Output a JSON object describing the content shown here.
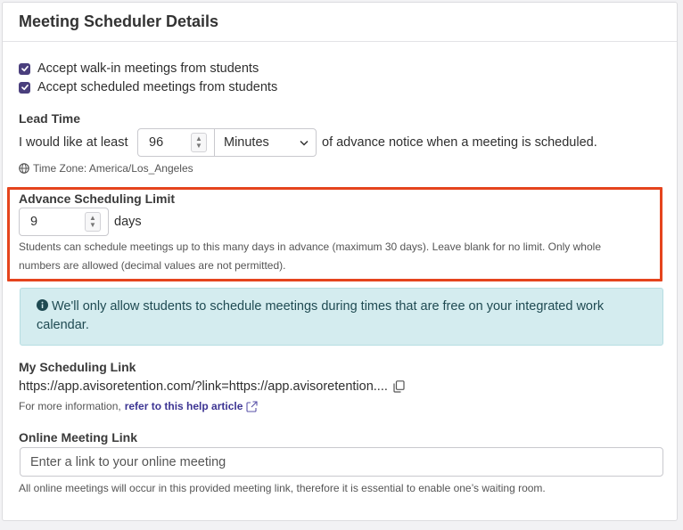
{
  "header": {
    "title": "Meeting Scheduler Details"
  },
  "checkboxes": [
    {
      "label": "Accept walk-in meetings from students",
      "checked": true
    },
    {
      "label": "Accept scheduled meetings from students",
      "checked": true
    }
  ],
  "lead_time": {
    "heading": "Lead Time",
    "prefix": "I would like at least",
    "value": "96",
    "unit_selected": "Minutes",
    "suffix": "of advance notice when a meeting is scheduled.",
    "timezone": "Time Zone: America/Los_Angeles"
  },
  "advance_limit": {
    "heading": "Advance Scheduling Limit",
    "value": "9",
    "unit": "days",
    "help_line1": "Students can schedule meetings up to this many days in advance (maximum 30 days). Leave blank for no limit. Only whole",
    "help_line2": "numbers are allowed (decimal values are not permitted)."
  },
  "alert": {
    "text": "We'll only allow students to schedule meetings during times that are free on your integrated work calendar."
  },
  "scheduling_link": {
    "heading": "My Scheduling Link",
    "url": "https://app.avisoretention.com/?link=https://app.avisoretention....",
    "info_prefix": "For more information,",
    "info_link": "refer to this help article"
  },
  "online_meeting": {
    "heading": "Online Meeting Link",
    "placeholder": "Enter a link to your online meeting",
    "help": "All online meetings will occur in this provided meeting link, therefore it is essential to enable one’s waiting room."
  },
  "colors": {
    "accent": "#4a3f7d",
    "highlight_border": "#e5441d",
    "alert_bg": "#d4ecef",
    "link": "#3d3593"
  }
}
